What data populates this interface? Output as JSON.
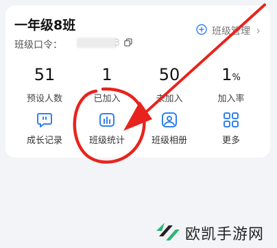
{
  "header": {
    "class_name": "一年级8班",
    "code_label": "班级口令：",
    "code_tail": "3",
    "manage_label": "班级管理",
    "manage_chevron": "›"
  },
  "stats": [
    {
      "value": "51",
      "unit": "",
      "label": "预设人数"
    },
    {
      "value": "1",
      "unit": "",
      "label": "已加入"
    },
    {
      "value": "50",
      "unit": "",
      "label": "未加入"
    },
    {
      "value": "1",
      "unit": "%",
      "label": "加入率"
    }
  ],
  "tools": [
    {
      "label": "成长记录",
      "icon": "chat-bubble-icon"
    },
    {
      "label": "班级统计",
      "icon": "bar-chart-icon"
    },
    {
      "label": "班级相册",
      "icon": "photo-album-icon"
    },
    {
      "label": "更多",
      "icon": "grid-more-icon"
    }
  ],
  "annotation": {
    "arrow_color": "#e8231d",
    "circle_color": "#e8231d"
  },
  "watermark": {
    "text": "欧凯手游网"
  },
  "colors": {
    "accent": "#2f80ed",
    "page_bg": "#f2f4f7",
    "card_bg": "#ffffff"
  }
}
